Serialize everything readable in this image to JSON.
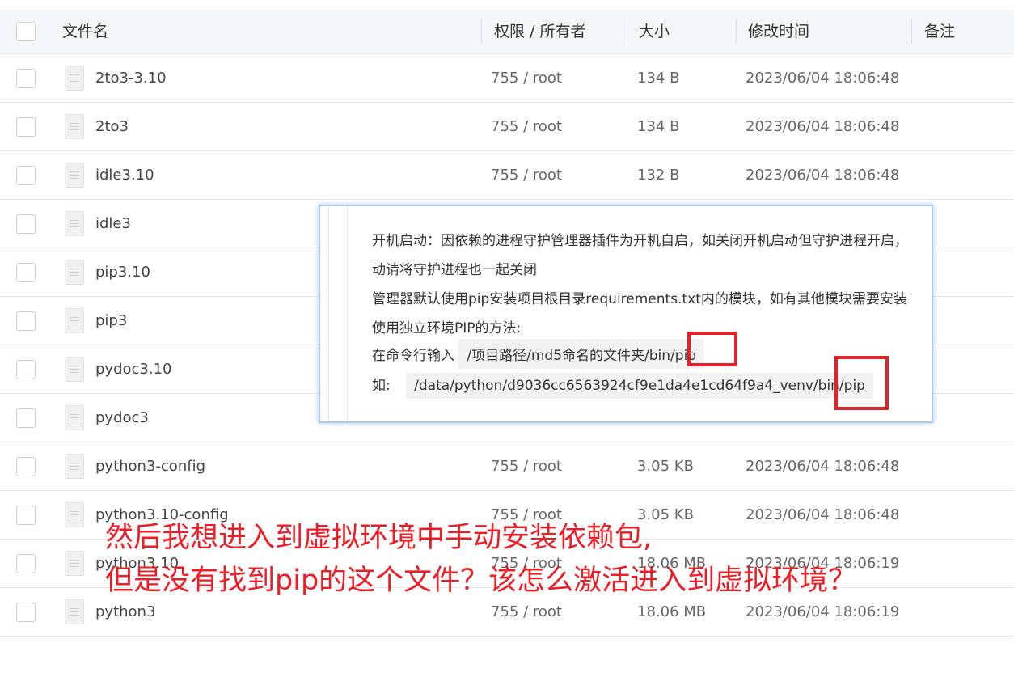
{
  "table": {
    "headers": {
      "name": "文件名",
      "permission": "权限 / 所有者",
      "size": "大小",
      "modified": "修改时间",
      "note": "备注"
    },
    "rows": [
      {
        "name": "2to3-3.10",
        "permission": "755 / root",
        "size": "134 B",
        "modified": "2023/06/04 18:06:48"
      },
      {
        "name": "2to3",
        "permission": "755 / root",
        "size": "134 B",
        "modified": "2023/06/04 18:06:48"
      },
      {
        "name": "idle3.10",
        "permission": "755 / root",
        "size": "132 B",
        "modified": "2023/06/04 18:06:48"
      },
      {
        "name": "idle3",
        "permission": "",
        "size": "",
        "modified": ""
      },
      {
        "name": "pip3.10",
        "permission": "",
        "size": "",
        "modified": ""
      },
      {
        "name": "pip3",
        "permission": "",
        "size": "",
        "modified": ""
      },
      {
        "name": "pydoc3.10",
        "permission": "",
        "size": "",
        "modified": ""
      },
      {
        "name": "pydoc3",
        "permission": "",
        "size": "",
        "modified": ""
      },
      {
        "name": "python3-config",
        "permission": "755 / root",
        "size": "3.05 KB",
        "modified": "2023/06/04 18:06:48"
      },
      {
        "name": "python3.10-config",
        "permission": "755 / root",
        "size": "3.05 KB",
        "modified": "2023/06/04 18:06:48"
      },
      {
        "name": "python3.10",
        "permission": "755 / root",
        "size": "18.06 MB",
        "modified": "2023/06/04 18:06:19"
      },
      {
        "name": "python3",
        "permission": "755 / root",
        "size": "18.06 MB",
        "modified": "2023/06/04 18:06:19"
      }
    ]
  },
  "tooltip": {
    "line1": "开机启动：因依赖的进程守护管理器插件为开机自启，如关闭开机启动但守护进程开启，",
    "line2": "动请将守护进程也一起关闭",
    "line3": "管理器默认使用pip安装项目根目录requirements.txt内的模块，如有其他模块需要安装",
    "line4": "使用独立环境PIP的方法:",
    "line5_label": "在命令行输入",
    "line5_code": "/项目路径/md5命名的文件夹/bin/pip",
    "line6_label": "如:",
    "line6_code": "/data/python/d9036cc6563924cf9e1da4e1cd64f9a4_venv/bin/pip"
  },
  "overlay": {
    "line1": "然后我想进入到虚拟环境中手动安装依赖包,",
    "line2": "但是没有找到pip的这个文件？该怎么激活进入到虚拟环境？"
  },
  "colors": {
    "annotation_red": "#ee1c25",
    "highlight_box": "#e3232c",
    "tooltip_border": "#a9c9f3"
  }
}
